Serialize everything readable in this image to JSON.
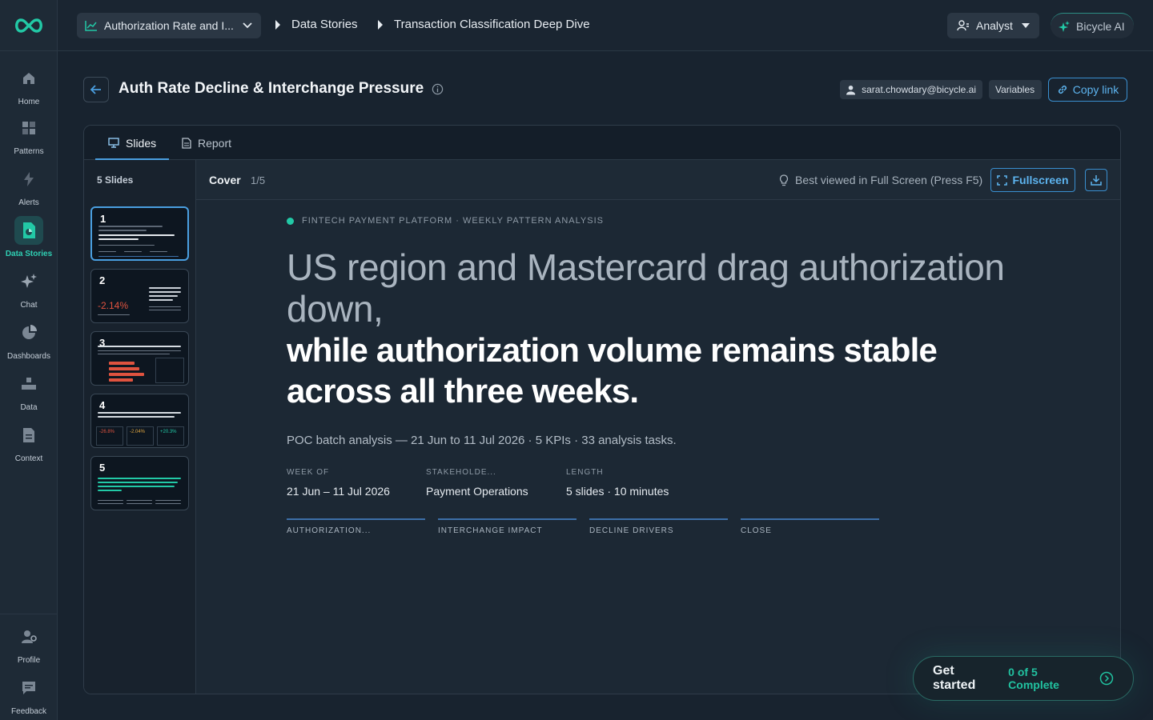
{
  "nav": {
    "items": [
      {
        "label": "Home",
        "icon": "home-icon"
      },
      {
        "label": "Patterns",
        "icon": "patterns-icon"
      },
      {
        "label": "Alerts",
        "icon": "alerts-icon"
      },
      {
        "label": "Data Stories",
        "icon": "data-stories-icon",
        "active": true
      },
      {
        "label": "Chat",
        "icon": "chat-sparkle-icon"
      },
      {
        "label": "Dashboards",
        "icon": "dashboards-icon"
      },
      {
        "label": "Data",
        "icon": "data-icon"
      },
      {
        "label": "Context",
        "icon": "context-icon"
      }
    ],
    "bottom": [
      {
        "label": "Profile",
        "icon": "profile-icon"
      },
      {
        "label": "Feedback",
        "icon": "feedback-icon"
      }
    ]
  },
  "topbar": {
    "kpi_selector": "Authorization Rate and I...",
    "breadcrumb": [
      "Data Stories",
      "Transaction Classification Deep Dive"
    ],
    "role": "Analyst",
    "ai_button": "Bicycle AI"
  },
  "header": {
    "title": "Auth Rate Decline & Interchange Pressure",
    "user_email": "sarat.chowdary@bicycle.ai",
    "variables_label": "Variables",
    "copy_link_label": "Copy link"
  },
  "tabs": [
    {
      "label": "Slides",
      "active": true
    },
    {
      "label": "Report",
      "active": false
    }
  ],
  "sidebar": {
    "count_label": "5 Slides",
    "slides": [
      {
        "number": "1",
        "active": true
      },
      {
        "number": "2",
        "active": false,
        "highlight": "-2.14%"
      },
      {
        "number": "3",
        "active": false
      },
      {
        "number": "4",
        "active": false,
        "highlights": [
          "-26.8%",
          "-2.04%",
          "+20.3%"
        ]
      },
      {
        "number": "5",
        "active": false
      }
    ]
  },
  "viewer": {
    "slide_name": "Cover",
    "slide_position": "1/5",
    "hint": "Best viewed in Full Screen (Press F5)",
    "fullscreen_label": "Fullscreen"
  },
  "slide": {
    "eyebrow": "FINTECH PAYMENT PLATFORM · WEEKLY PATTERN ANALYSIS",
    "headline_light": "US region and Mastercard drag authorization down,",
    "headline_bold": "while authorization volume remains stable across all three weeks.",
    "subline": "POC batch analysis — 21 Jun to 11 Jul 2026 · 5 KPIs · 33 analysis tasks.",
    "meta": [
      {
        "key": "WEEK OF",
        "value": "21 Jun – 11 Jul 2026"
      },
      {
        "key": "STAKEHOLDE...",
        "value": "Payment Operations"
      },
      {
        "key": "LENGTH",
        "value": "5 slides · 10 minutes"
      }
    ],
    "sections": [
      "AUTHORIZATION...",
      "INTERCHANGE IMPACT",
      "DECLINE DRIVERS",
      "CLOSE"
    ]
  },
  "get_started": {
    "title": "Get started",
    "progress": "0 of 5 Complete"
  },
  "colors": {
    "accent": "#4a9fe0",
    "brand_teal": "#22c9a6",
    "negative": "#e0533f"
  }
}
